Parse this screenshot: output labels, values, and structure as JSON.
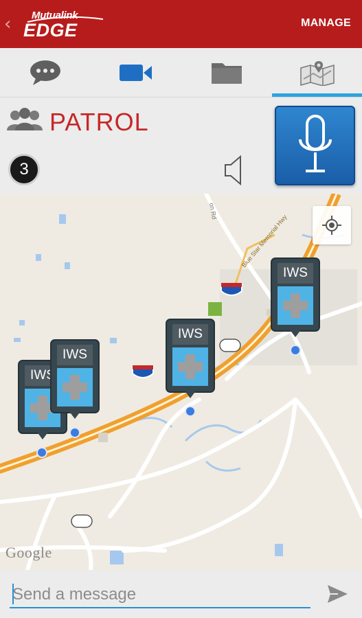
{
  "header": {
    "logo_top": "Mutualink",
    "logo_bottom": "EDGE",
    "manage_label": "MANAGE",
    "back_icon": "chevron-left-icon",
    "colors": {
      "bar": "#b71c1c"
    }
  },
  "tabs": [
    {
      "icon": "chat-bubble-icon"
    },
    {
      "icon": "video-camera-icon"
    },
    {
      "icon": "folder-icon"
    },
    {
      "icon": "map-icon",
      "selected": true
    }
  ],
  "channel": {
    "name": "PATROL",
    "participant_count": "3",
    "icons": [
      "people-icon",
      "speaker-icon",
      "microphone-icon"
    ],
    "accent": "#c62828"
  },
  "map": {
    "road_label": "Blue Star Memorial Hwy",
    "road_label_2": "on Rd",
    "attribution": "Google",
    "markers": [
      {
        "label": "IWS"
      },
      {
        "label": "IWS"
      },
      {
        "label": "IWS"
      },
      {
        "label": "IWS"
      }
    ],
    "locate_icon": "my-location-icon"
  },
  "composer": {
    "placeholder": "Send a message",
    "value": "",
    "send_icon": "send-icon"
  }
}
